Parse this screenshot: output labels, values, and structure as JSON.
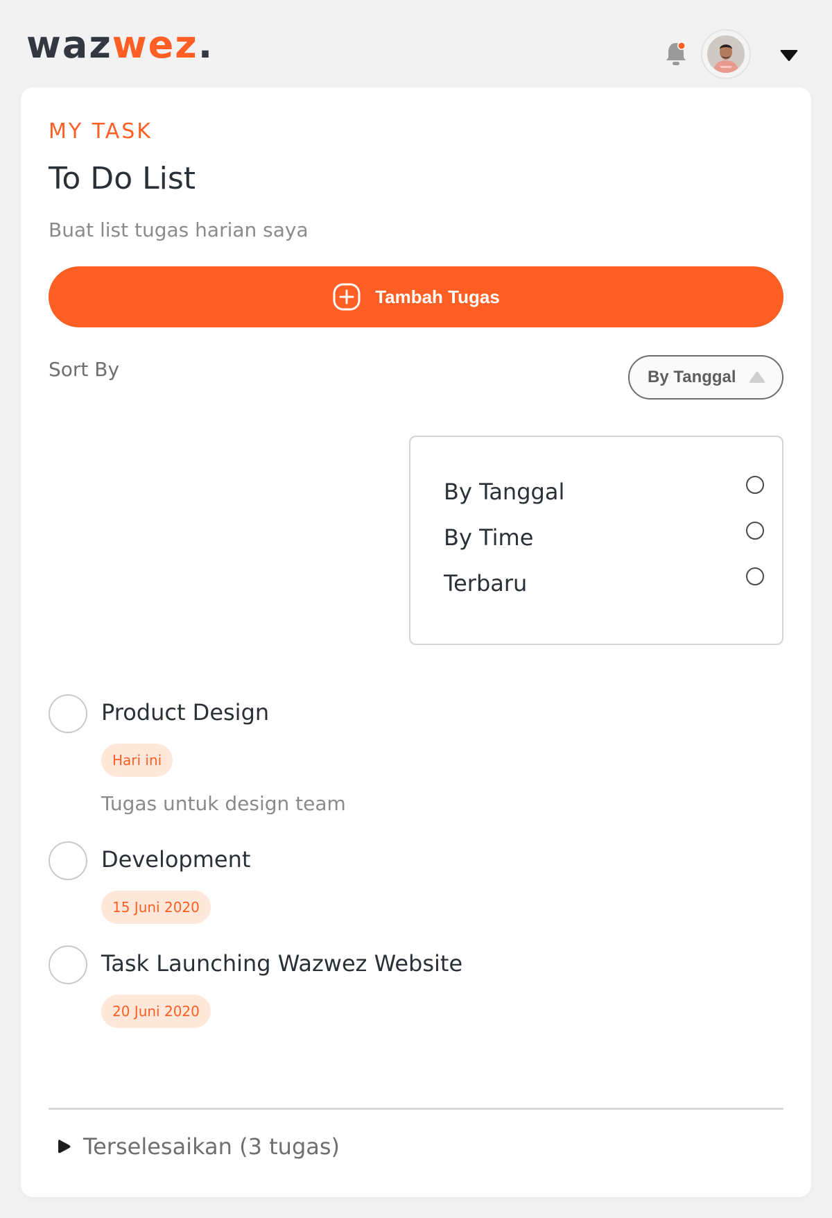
{
  "brand": {
    "logo_part1": "waz",
    "logo_part2": "wez",
    "logo_part3": ".",
    "accent_color": "#ff5f24"
  },
  "header": {
    "notification_icon": "bell-icon",
    "avatar_icon": "user-avatar",
    "menu_icon": "caret-down-icon"
  },
  "page": {
    "eyebrow": "MY TASK",
    "title": "To Do List",
    "subtitle": "Buat list tugas harian saya"
  },
  "add_button": {
    "label": "Tambah Tugas",
    "icon": "plus-circle-icon"
  },
  "sort": {
    "label": "Sort By",
    "selected": "By Tanggal",
    "open": true,
    "options": [
      {
        "label": "By Tanggal"
      },
      {
        "label": "By Time"
      },
      {
        "label": "Terbaru"
      }
    ]
  },
  "tasks": [
    {
      "name": "Product Design",
      "badge": "Hari ini",
      "description": "Tugas untuk design team"
    },
    {
      "name": "Development",
      "badge": "15 Juni 2020"
    },
    {
      "name": "Task Launching Wazwez Website",
      "badge": "20 Juni 2020"
    }
  ],
  "completed": {
    "label": "Terselesaikan (3 tugas)"
  }
}
